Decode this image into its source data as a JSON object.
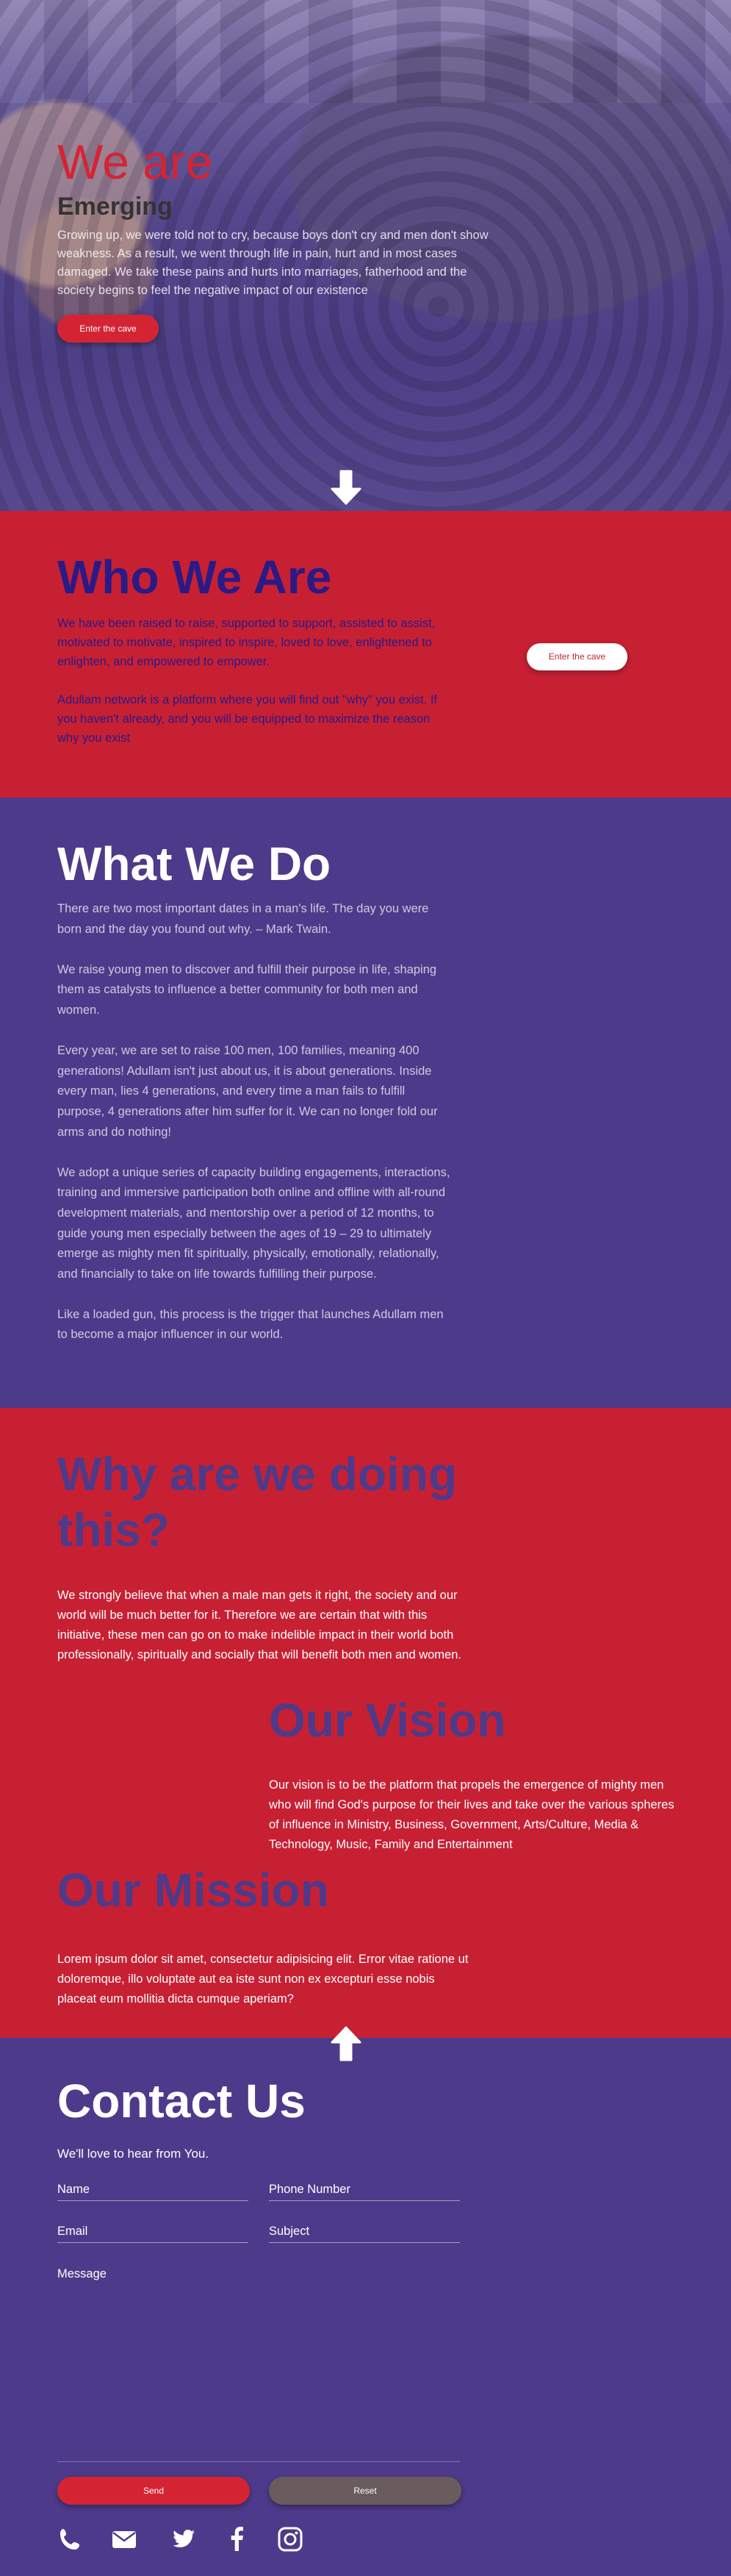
{
  "hero": {
    "title": "We are",
    "subtitle": "Emerging",
    "text": "Growing up, we were told not to cry, because boys don't cry and men don't show weakness. As a result, we went through life in pain, hurt and in most cases damaged. We take these pains and hurts into marriages, fatherhood and the society begins to feel the negative impact of our existence",
    "button": "Enter the cave",
    "scroll_icon": "arrow-down-icon"
  },
  "who": {
    "title": "Who We Are",
    "paragraphs": [
      "We have been raised to raise, supported to support, assisted to assist, motivated to motivate, inspired to inspire, loved to love, enlightened to enlighten, and empowered to empower.",
      "Adullam network is a platform where you will find out \"why\" you exist. If you haven't already, and you will be equipped to maximize the reason why you exist"
    ],
    "button": "Enter the cave"
  },
  "what": {
    "title": "What We Do",
    "paragraphs": [
      "There are two most important dates in a man's life. The day you were born and the day you found out why. – Mark Twain.",
      "We raise young men to discover and fulfill their purpose in life, shaping them as catalysts to influence a better community for both men and women.",
      "Every year, we are set to raise 100 men, 100 families, meaning 400 generations! Adullam isn't just about us, it is about generations. Inside every man, lies 4 generations, and every time a man fails to fulfill purpose, 4 generations after him suffer for it. We can no longer fold our arms and do nothing!",
      "We adopt a unique series of capacity building engagements, interactions, training and immersive participation both online and offline with all-round development materials, and mentorship over a period of 12 months, to guide young men especially between the ages of 19 – 29 to ultimately emerge as mighty men fit spiritually, physically, emotionally, relationally, and financially to take on life towards fulfilling their purpose.",
      "Like a loaded gun, this process is the trigger that launches Adullam men to become a major influencer in our world."
    ]
  },
  "why": {
    "title": "Why are we doing this?",
    "text": "We strongly believe that when a male man gets it right, the society and our world will be much better for it. Therefore we are certain that with this initiative, these men can go on to make indelible impact in their world both professionally, spiritually and socially that will benefit both men and women.",
    "vision_title": "Our Vision",
    "vision_text": "Our vision is to be the platform that propels the emergence of mighty men who will find God's purpose for their lives and take over the various spheres of influence in Ministry, Business, Government, Arts/Culture, Media & Technology, Music, Family and Entertainment",
    "mission_title": "Our Mission",
    "mission_text": "Lorem ipsum dolor sit amet, consectetur adipisicing elit. Error vitae ratione ut doloremque, illo voluptate aut ea iste sunt non ex excepturi esse nobis placeat eum mollitia dicta cumque aperiam?"
  },
  "contact": {
    "title": "Contact Us",
    "subtitle": "We'll love to hear from You.",
    "name_placeholder": "Name",
    "phone_placeholder": "Phone Number",
    "email_placeholder": "Email",
    "subject_placeholder": "Subject",
    "message_placeholder": "Message",
    "send_label": "Send",
    "reset_label": "Reset",
    "scroll_icon": "arrow-up-icon",
    "social_icons": [
      "phone-icon",
      "mail-icon",
      "twitter-icon",
      "facebook-icon",
      "instagram-icon"
    ]
  },
  "colors": {
    "red": "#c72033",
    "purple": "#4e3a8a",
    "navy": "#2a1a86",
    "reset_gray": "#6a5c5c"
  }
}
